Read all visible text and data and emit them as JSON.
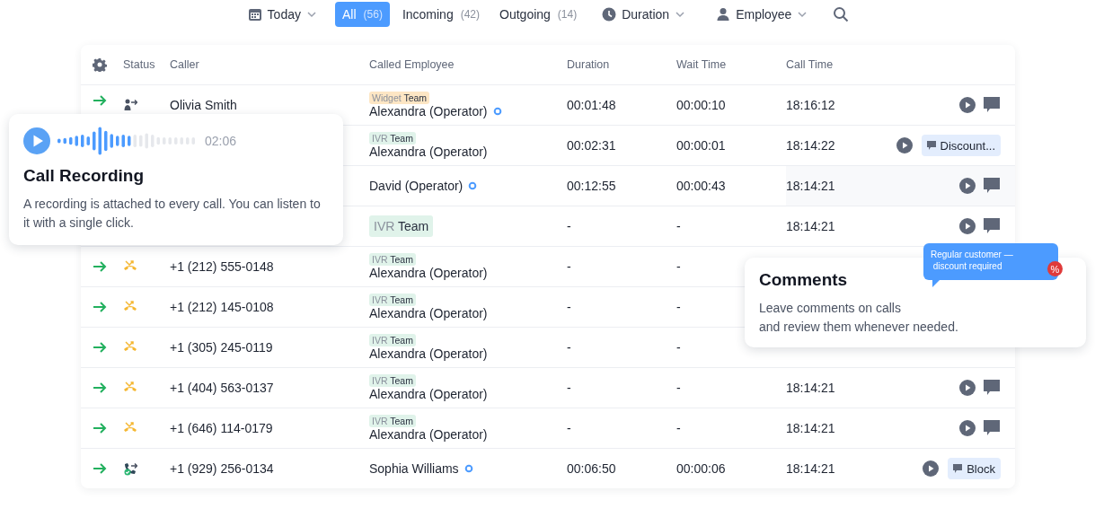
{
  "filters": [
    {
      "kind": "date",
      "label": "Today"
    },
    {
      "kind": "tab",
      "label": "All",
      "count": "(56)",
      "selected": true
    },
    {
      "kind": "tab",
      "label": "Incoming",
      "count": "(42)",
      "selected": false
    },
    {
      "kind": "tab",
      "label": "Outgoing",
      "count": "(14)",
      "selected": false
    },
    {
      "kind": "duration",
      "label": "Duration"
    },
    {
      "kind": "employee",
      "label": "Employee"
    },
    {
      "kind": "search"
    }
  ],
  "table": {
    "columns": [
      "Status",
      "Caller",
      "Called Employee",
      "Duration",
      "Wait Time",
      "Call Time"
    ],
    "rows": [
      {
        "kind": "transfer",
        "caller": "Olivia Smith",
        "team": {
          "kind": "small",
          "name": "Widget",
          "suffix": "Team",
          "color": "#fde6c4"
        },
        "employee": "Alexandra (Operator)",
        "online": true,
        "duration": "00:01:48",
        "wait": "00:00:10",
        "time": "18:16:12",
        "comment": {
          "kind": "icon"
        }
      },
      {
        "team": {
          "kind": "small",
          "name": "IVR",
          "suffix": "Team",
          "color": "#e0f3ea"
        },
        "employee": "Alexandra (Operator)",
        "online": false,
        "duration": "00:02:31",
        "wait": "00:00:01",
        "time": "18:14:22",
        "comment": {
          "kind": "chip",
          "text": "Discount..."
        }
      },
      {
        "employee": "David (Operator)",
        "online": true,
        "duration": "00:12:55",
        "wait": "00:00:43",
        "time": "18:14:21",
        "highlighted": true,
        "comment": {
          "kind": "icon"
        }
      },
      {
        "team": {
          "kind": "large",
          "name": "IVR",
          "suffix": "Team",
          "color": "#e0f3ea"
        },
        "duration": "-",
        "wait": "-",
        "time": "18:14:21",
        "comment": {
          "kind": "icon"
        }
      },
      {
        "kind": "missed",
        "caller": "+1 (212) 555-0148",
        "team": {
          "kind": "small",
          "name": "IVR",
          "suffix": "Team",
          "color": "#e0f3ea"
        },
        "employee": "Alexandra (Operator)",
        "online": false,
        "duration": "-",
        "wait": "-"
      },
      {
        "kind": "missed",
        "caller": "+1 (212) 145-0108",
        "team": {
          "kind": "small",
          "name": "IVR",
          "suffix": "Team",
          "color": "#e0f3ea"
        },
        "employee": "Alexandra (Operator)",
        "online": false,
        "duration": "-",
        "wait": "-"
      },
      {
        "kind": "missed",
        "caller": "+1 (305) 245-0119",
        "team": {
          "kind": "small",
          "name": "IVR",
          "suffix": "Team",
          "color": "#e0f3ea"
        },
        "employee": "Alexandra (Operator)",
        "online": false,
        "duration": "-",
        "wait": "-"
      },
      {
        "kind": "missed",
        "caller": "+1 (404) 563-0137",
        "team": {
          "kind": "small",
          "name": "IVR",
          "suffix": "Team",
          "color": "#e0f3ea"
        },
        "employee": "Alexandra (Operator)",
        "online": false,
        "duration": "-",
        "wait": "-",
        "time": "18:14:21",
        "comment": {
          "kind": "icon"
        }
      },
      {
        "kind": "missed",
        "caller": "+1 (646) 114-0179",
        "team": {
          "kind": "small",
          "name": "IVR",
          "suffix": "Team",
          "color": "#e0f3ea"
        },
        "employee": "Alexandra (Operator)",
        "online": false,
        "duration": "-",
        "wait": "-",
        "time": "18:14:21",
        "comment": {
          "kind": "icon"
        }
      },
      {
        "kind": "answered",
        "caller": "+1 (929) 256-0134",
        "employee": "Sophia Williams",
        "online": true,
        "duration": "00:06:50",
        "wait": "00:00:06",
        "time": "18:14:21",
        "comment": {
          "kind": "chip",
          "text": "Block"
        }
      }
    ]
  },
  "recording_card": {
    "length": "02:06",
    "level": 0.55,
    "title": "Call Recording",
    "description": "A recording is attached to every call. You can listen to it with a single click."
  },
  "comments_card": {
    "bubble": "Regular customer —\n discount required",
    "badge": "%",
    "title": "Comments",
    "description": "Leave comments on calls\nand review them whenever needed."
  }
}
